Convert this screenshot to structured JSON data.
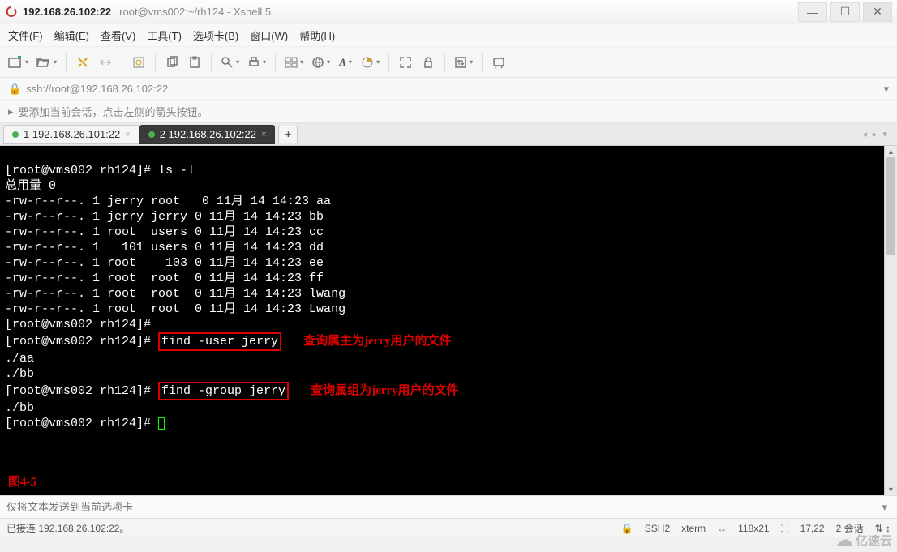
{
  "titlebar": {
    "ip": "192.168.26.102:22",
    "sub": "root@vms002:~/rh124 - Xshell 5",
    "min": "—",
    "max": "☐",
    "close": "✕"
  },
  "menu": {
    "file": "文件(F)",
    "edit": "编辑(E)",
    "view": "查看(V)",
    "tools": "工具(T)",
    "tabs": "选项卡(B)",
    "window": "窗口(W)",
    "help": "帮助(H)"
  },
  "address": {
    "url": "ssh://root@192.168.26.102:22"
  },
  "hint": {
    "text": "要添加当前会话，点击左侧的箭头按钮。"
  },
  "tabs": {
    "t1": "1 192.168.26.101:22",
    "t2": "2 192.168.26.102:22",
    "plus": "+",
    "nav": "◂ ▸ ▾"
  },
  "term": {
    "l1p": "[root@vms002 rh124]# ",
    "l1c": "ls -l",
    "l2": "总用量 0",
    "l3": "-rw-r--r--. 1 jerry root   0 11月 14 14:23 aa",
    "l4": "-rw-r--r--. 1 jerry jerry 0 11月 14 14:23 bb",
    "l5": "-rw-r--r--. 1 root  users 0 11月 14 14:23 cc",
    "l6": "-rw-r--r--. 1   101 users 0 11月 14 14:23 dd",
    "l7": "-rw-r--r--. 1 root    103 0 11月 14 14:23 ee",
    "l8": "-rw-r--r--. 1 root  root  0 11月 14 14:23 ff",
    "l9": "-rw-r--r--. 1 root  root  0 11月 14 14:23 lwang",
    "l10": "-rw-r--r--. 1 root  root  0 11月 14 14:23 Lwang",
    "l11p": "[root@vms002 rh124]#",
    "l12p": "[root@vms002 rh124]# ",
    "l12c": "find -user jerry",
    "l12a": "查询属主为jerry用户的文件",
    "l13": "./aa",
    "l14": "./bb",
    "l15p": "[root@vms002 rh124]# ",
    "l15c": "find -group jerry",
    "l15a": "查询属组为jerry用户的文件",
    "l16": "./bb",
    "l17p": "[root@vms002 rh124]# ",
    "fig": "图4-5"
  },
  "inputbar": {
    "placeholder": "仅将文本发送到当前选项卡"
  },
  "status": {
    "left": "已接连 192.168.26.102:22。",
    "proto": "SSH2",
    "termtype": "xterm",
    "size": "118x21",
    "pos": "17,22",
    "sessions": "2 会话",
    "arrows": "⇅  ↕"
  },
  "watermark": "亿速云"
}
